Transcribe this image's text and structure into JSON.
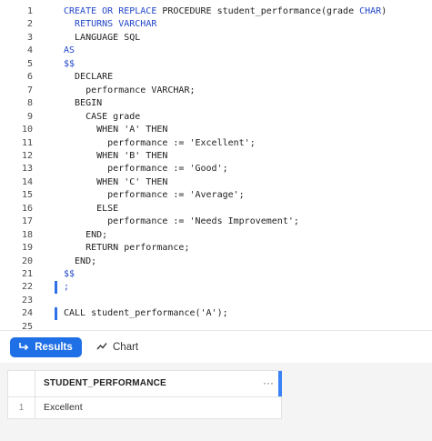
{
  "editor": {
    "lines": [
      {
        "n": "1",
        "parts": [
          [
            "kw",
            "CREATE OR REPLACE"
          ],
          [
            "t",
            " PROCEDURE student_performance(grade "
          ],
          [
            "kw",
            "CHAR"
          ],
          [
            "t",
            ")"
          ]
        ]
      },
      {
        "n": "2",
        "parts": [
          [
            "t",
            "  "
          ],
          [
            "kw",
            "RETURNS VARCHAR"
          ]
        ]
      },
      {
        "n": "3",
        "parts": [
          [
            "t",
            "  LANGUAGE SQL"
          ]
        ]
      },
      {
        "n": "4",
        "parts": [
          [
            "kw",
            "AS"
          ]
        ]
      },
      {
        "n": "5",
        "parts": [
          [
            "kw",
            "$$"
          ]
        ]
      },
      {
        "n": "6",
        "parts": [
          [
            "t",
            "  DECLARE"
          ]
        ]
      },
      {
        "n": "7",
        "parts": [
          [
            "t",
            "    performance VARCHAR;"
          ]
        ]
      },
      {
        "n": "8",
        "parts": [
          [
            "t",
            "  BEGIN"
          ]
        ]
      },
      {
        "n": "9",
        "parts": [
          [
            "t",
            "    CASE grade"
          ]
        ]
      },
      {
        "n": "10",
        "parts": [
          [
            "t",
            "      WHEN 'A' THEN"
          ]
        ]
      },
      {
        "n": "11",
        "parts": [
          [
            "t",
            "        performance := 'Excellent';"
          ]
        ]
      },
      {
        "n": "12",
        "parts": [
          [
            "t",
            "      WHEN 'B' THEN"
          ]
        ]
      },
      {
        "n": "13",
        "parts": [
          [
            "t",
            "        performance := 'Good';"
          ]
        ]
      },
      {
        "n": "14",
        "parts": [
          [
            "t",
            "      WHEN 'C' THEN"
          ]
        ]
      },
      {
        "n": "15",
        "parts": [
          [
            "t",
            "        performance := 'Average';"
          ]
        ]
      },
      {
        "n": "16",
        "parts": [
          [
            "t",
            "      ELSE"
          ]
        ]
      },
      {
        "n": "17",
        "parts": [
          [
            "t",
            "        performance := 'Needs Improvement';"
          ]
        ]
      },
      {
        "n": "18",
        "parts": [
          [
            "t",
            "    END;"
          ]
        ]
      },
      {
        "n": "19",
        "parts": [
          [
            "t",
            "    RETURN performance;"
          ]
        ]
      },
      {
        "n": "20",
        "parts": [
          [
            "t",
            "  END;"
          ]
        ]
      },
      {
        "n": "21",
        "parts": [
          [
            "kw",
            "$$"
          ]
        ]
      },
      {
        "n": "22",
        "parts": [
          [
            "kw",
            ";"
          ]
        ]
      },
      {
        "n": "23",
        "parts": []
      },
      {
        "n": "24",
        "parts": [
          [
            "t",
            "CALL student_performance('A');"
          ]
        ]
      },
      {
        "n": "25",
        "parts": []
      }
    ],
    "cursor_lines": [
      "22",
      "24"
    ]
  },
  "tabs": {
    "results_label": "Results",
    "chart_label": "Chart",
    "results_icon": "enter-arrow-icon",
    "chart_icon": "line-chart-icon",
    "accent_color": "#1f6fe6"
  },
  "results": {
    "columns": [
      "STUDENT_PERFORMANCE"
    ],
    "menu_glyph": "···",
    "rows": [
      {
        "num": "1",
        "values": [
          "Excellent"
        ]
      }
    ]
  }
}
